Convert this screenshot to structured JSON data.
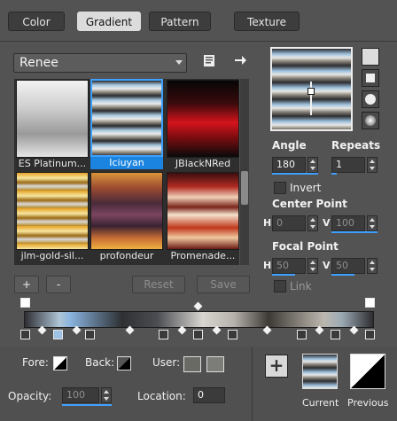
{
  "tabs": [
    {
      "label": "Color"
    },
    {
      "label": "Gradient",
      "active": true
    },
    {
      "label": "Pattern"
    },
    {
      "label": "Texture"
    }
  ],
  "preset": {
    "selected": "Renee"
  },
  "gradients": [
    {
      "name": "ES Platinum...",
      "selected": false
    },
    {
      "name": "Iciuyan",
      "selected": true
    },
    {
      "name": "JBlackNRed",
      "selected": false
    },
    {
      "name": "jlm-gold-sil...",
      "selected": false
    },
    {
      "name": "profondeur",
      "selected": false
    },
    {
      "name": "Promenade...",
      "selected": false
    }
  ],
  "buttons": {
    "add": "+",
    "remove": "-",
    "reset": "Reset",
    "save": "Save"
  },
  "angle": {
    "label": "Angle",
    "value": "180"
  },
  "repeats": {
    "label": "Repeats",
    "value": "1"
  },
  "invert": {
    "label": "Invert"
  },
  "center_point": {
    "label": "Center Point",
    "h_label": "H",
    "h_value": "0",
    "v_label": "V",
    "v_value": "100"
  },
  "focal_point": {
    "label": "Focal Point",
    "h_label": "H",
    "h_value": "50",
    "v_label": "V",
    "v_value": "50"
  },
  "link": {
    "label": "Link"
  },
  "footer": {
    "fore_label": "Fore:",
    "back_label": "Back:",
    "user_label": "User:",
    "opacity_label": "Opacity:",
    "opacity_value": "100",
    "location_label": "Location:",
    "location_value": "0",
    "current_label": "Current",
    "previous_label": "Previous",
    "add": "+"
  },
  "colors": {
    "accent": "#3fa1ff",
    "panel": "#535353"
  },
  "icons": [
    "save-preset-icon",
    "arrow-right-icon",
    "plus-icon"
  ]
}
